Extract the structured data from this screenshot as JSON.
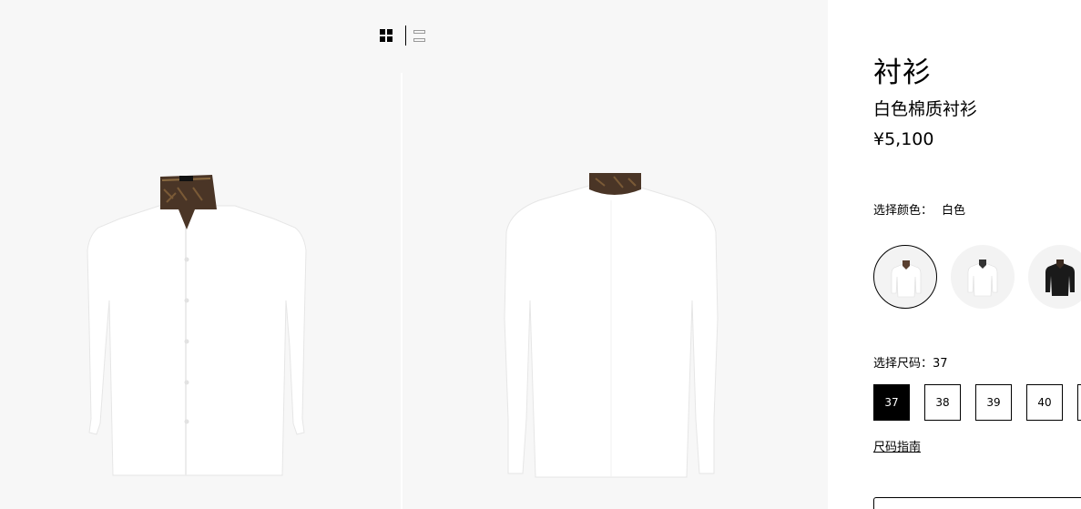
{
  "gallery": {
    "view_toggle": {
      "grid_icon": "grid-view-icon",
      "list_icon": "list-view-icon"
    },
    "images": [
      {
        "name": "shirt-front-image",
        "view": "front"
      },
      {
        "name": "shirt-back-image",
        "view": "back"
      }
    ]
  },
  "product": {
    "title": "衬衫",
    "subtitle": "白色棉质衬衫",
    "price": "¥5,100"
  },
  "color": {
    "label": "选择颜色：",
    "selected": "白色",
    "options": [
      {
        "name": "white-ff-collar",
        "body_color": "#ffffff",
        "collar_color": "#5a4030"
      },
      {
        "name": "white-ff-collar-alt",
        "body_color": "#ffffff",
        "collar_color": "#333333"
      },
      {
        "name": "black",
        "body_color": "#1a1a1a",
        "collar_color": "#3a2a20"
      }
    ]
  },
  "size": {
    "label": "选择尺码：37",
    "options": [
      "37",
      "38",
      "39",
      "40",
      ""
    ],
    "selected": "37",
    "guide": "尺码指南"
  },
  "colors": {
    "background_gallery": "#f7f7f7",
    "accent": "#000000",
    "collar": "#4a3526"
  }
}
